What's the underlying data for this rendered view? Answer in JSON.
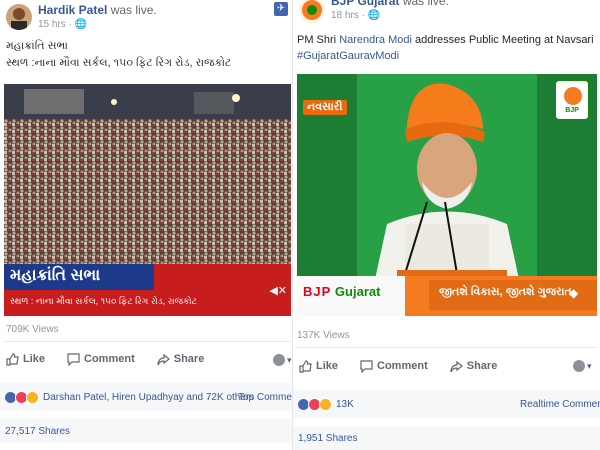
{
  "left_post": {
    "author": "Hardik Patel",
    "action": "was live.",
    "time": "15 hrs",
    "body_line1": "મહાક્રાંતિ સભા",
    "body_line2": "સ્થળ :નાના મૌવા સર્કલ, ૧૫૦ ફિટ રિંગ રોડ, રાજકોટ",
    "video_banner_title": "મહાક્રાંતિ સભા",
    "video_banner_sub": "સ્થળ : નાના મૌવા સર્કલ, ૧૫૦ ફિટ રિંગ રોડ, રાજકોટ",
    "views": "709K Views",
    "like_label": "Like",
    "comment_label": "Comment",
    "share_label": "Share",
    "reaction_names": "Darshan Patel, Hiren Upadhyay and 72K others",
    "comments_order": "Top Comments",
    "shares": "27,517 Shares",
    "icons": [
      "globe-icon",
      "pin-icon",
      "mute-icon"
    ]
  },
  "right_post": {
    "author": "BJP Gujarat",
    "action": "was live.",
    "time": "18 hrs",
    "body_prefix": "PM Shri ",
    "body_mention": "Narendra Modi",
    "body_suffix": " addresses Public Meeting at Navsari",
    "hashtag": "#GujaratGauravModi",
    "video_city_tag": "નવસારી",
    "video_logo_text": "BJP",
    "video_brand": "Gujarat",
    "video_slogan": "જીતશે વિકાસ, જીતશે ગુજરાત",
    "views": "137K Views",
    "like_label": "Like",
    "comment_label": "Comment",
    "share_label": "Share",
    "reaction_count": "13K",
    "comments_order": "Realtime Comments ▾",
    "shares": "1,951 Shares"
  },
  "colors": {
    "facebook_blue": "#365899",
    "bjp_orange": "#f47b20",
    "bjp_green": "#138808",
    "banner_red": "#e2001a"
  }
}
